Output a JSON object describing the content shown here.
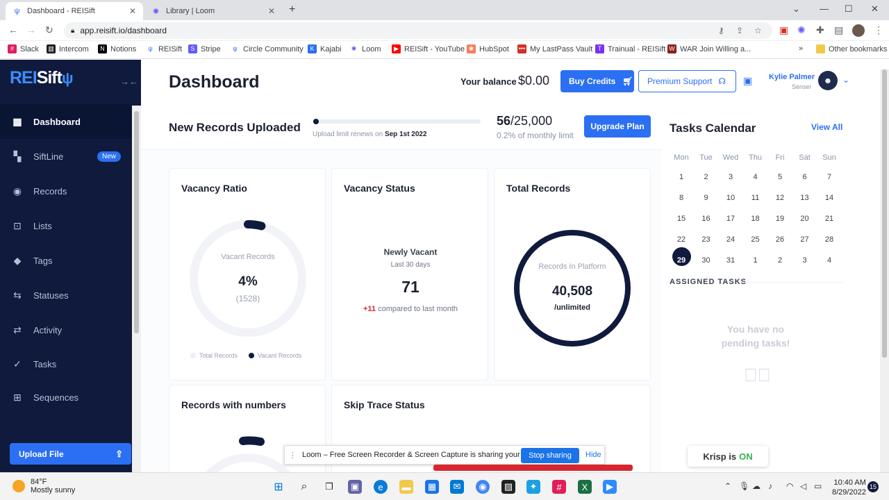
{
  "browser": {
    "tabs": [
      {
        "label": "Dashboard - REISift",
        "icon": "reisift-icon"
      },
      {
        "label": "Library | Loom",
        "icon": "loom-icon"
      }
    ],
    "url": "app.reisift.io/dashboard",
    "bookmarks": [
      "Slack",
      "Intercom",
      "Notions",
      "REISift",
      "Stripe",
      "Circle Community",
      "Kajabi",
      "Loom",
      "REISift - YouTube",
      "HubSpot",
      "My LastPass Vault",
      "Trainual - REISift",
      "WAR Join Willing a..."
    ],
    "other_bookmarks": "Other bookmarks"
  },
  "sidebar": {
    "logo_rei": "REI",
    "logo_sift": "Sift",
    "items": [
      {
        "label": "Dashboard",
        "icon": "dashboard-icon"
      },
      {
        "label": "SiftLine",
        "icon": "siftline-icon",
        "badge": "New"
      },
      {
        "label": "Records",
        "icon": "records-icon"
      },
      {
        "label": "Lists",
        "icon": "lists-icon"
      },
      {
        "label": "Tags",
        "icon": "tags-icon"
      },
      {
        "label": "Statuses",
        "icon": "statuses-icon"
      },
      {
        "label": "Activity",
        "icon": "activity-icon"
      },
      {
        "label": "Tasks",
        "icon": "tasks-icon"
      },
      {
        "label": "Sequences",
        "icon": "sequences-icon"
      }
    ],
    "upload_label": "Upload File"
  },
  "header": {
    "title": "Dashboard",
    "balance_label": "Your balance",
    "balance_value": "$0.00",
    "buy_credits": "Buy Credits",
    "premium_support": "Premium Support",
    "user_name": "Kylie Palmer",
    "user_role": "Sensei"
  },
  "records_bar": {
    "title": "New Records Uploaded",
    "renew_text": "Upload limit renews on",
    "renew_date": "Sep 1st 2022",
    "used": "56",
    "limit": "/25,000",
    "pct_text": "0.2% of monthly limit",
    "upgrade": "Upgrade Plan",
    "progress_fraction": 0.002
  },
  "cards": {
    "vacancy_ratio": {
      "title": "Vacancy Ratio",
      "center_label": "Vacant Records",
      "percent": "4%",
      "count": "(1528)",
      "legend_total": "Total Records",
      "legend_vacant": "Vacant Records",
      "vacant_fraction": 0.04
    },
    "vacancy_status": {
      "title": "Vacancy Status",
      "subtitle": "Newly Vacant",
      "period": "Last 30 days",
      "value": "71",
      "delta": "+11",
      "delta_text": "compared to last month"
    },
    "total_records": {
      "title": "Total Records",
      "center_label": "Records In Platform",
      "value": "40,508",
      "unit": "/unlimited"
    },
    "records_with_numbers": {
      "title": "Records with numbers"
    },
    "skip_trace_status": {
      "title": "Skip Trace Status"
    }
  },
  "tasks_calendar": {
    "title": "Tasks Calendar",
    "view_all": "View All",
    "weekdays": [
      "Mon",
      "Tue",
      "Wed",
      "Thu",
      "Fri",
      "Sat",
      "Sun"
    ],
    "weeks": [
      [
        "1",
        "2",
        "3",
        "4",
        "5",
        "6",
        "7"
      ],
      [
        "8",
        "9",
        "10",
        "11",
        "12",
        "13",
        "14"
      ],
      [
        "15",
        "16",
        "17",
        "18",
        "19",
        "20",
        "21"
      ],
      [
        "22",
        "23",
        "24",
        "25",
        "26",
        "27",
        "28"
      ],
      [
        "29",
        "30",
        "31",
        "1",
        "2",
        "3",
        "4"
      ]
    ],
    "today": "29",
    "assigned_label": "ASSIGNED TASKS",
    "empty_text": "You have no pending tasks!"
  },
  "overlays": {
    "loom_text": "Loom – Free Screen Recorder & Screen Capture is sharing your screen.",
    "stop_sharing": "Stop sharing",
    "hide": "Hide",
    "krisp_label": "Krisp is",
    "krisp_state": "ON"
  },
  "taskbar": {
    "temp": "84°F",
    "weather": "Mostly sunny",
    "time": "10:40 AM",
    "date": "8/29/2022",
    "notifications": "15"
  }
}
